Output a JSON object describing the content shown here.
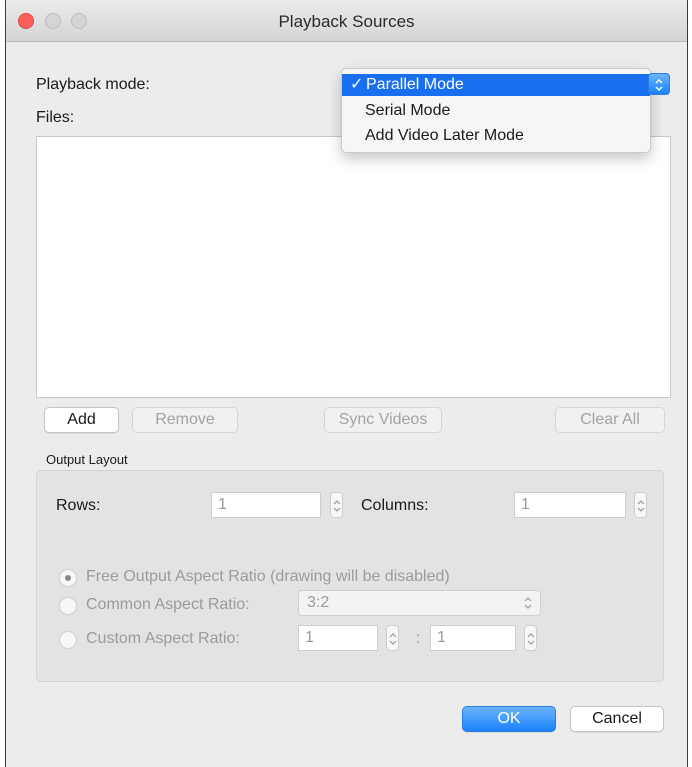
{
  "window": {
    "title": "Playback Sources"
  },
  "playback": {
    "mode_label": "Playback mode:",
    "menu": [
      {
        "label": "Parallel Mode",
        "selected": true,
        "check": "✓"
      },
      {
        "label": "Serial Mode",
        "selected": false
      },
      {
        "label": "Add Video Later Mode",
        "selected": false
      }
    ]
  },
  "files": {
    "label": "Files:"
  },
  "file_buttons": {
    "add": "Add",
    "remove": "Remove",
    "sync": "Sync Videos",
    "clear_all": "Clear All"
  },
  "output_layout": {
    "title": "Output Layout",
    "rows_label": "Rows:",
    "rows_value": "1",
    "columns_label": "Columns:",
    "columns_value": "1",
    "free_ratio_label": "Free Output Aspect Ratio (drawing will be disabled)",
    "common_ratio_label": "Common Aspect Ratio:",
    "common_ratio_value": "3:2",
    "custom_ratio_label": "Custom Aspect Ratio:",
    "custom_ratio_left": "1",
    "custom_ratio_separator": ":",
    "custom_ratio_right": "1"
  },
  "footer": {
    "ok": "OK",
    "cancel": "Cancel"
  },
  "colors": {
    "accent": "#1a82fb",
    "close": "#fc605b"
  }
}
